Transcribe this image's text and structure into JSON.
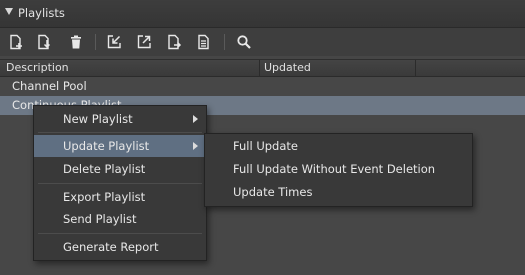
{
  "panel": {
    "title": "Playlists"
  },
  "toolbar": {
    "buttons": [
      {
        "icon": "new-playlist-icon"
      },
      {
        "icon": "import-playlist-icon"
      },
      {
        "icon": "trash-icon"
      },
      {
        "icon": "import-into-icon"
      },
      {
        "icon": "export-icon"
      },
      {
        "icon": "send-icon"
      },
      {
        "icon": "report-icon"
      },
      {
        "icon": "search-icon"
      }
    ]
  },
  "table": {
    "columns": [
      "Description",
      "Updated"
    ],
    "rows": [
      {
        "description": "Channel Pool",
        "updated": ""
      },
      {
        "description": "Continuous Playlist",
        "updated": ""
      }
    ]
  },
  "context_menu": {
    "items": [
      "New Playlist",
      "Update Playlist",
      "Delete Playlist",
      "Export Playlist",
      "Send Playlist",
      "Generate Report"
    ],
    "highlighted": "Update Playlist"
  },
  "submenu": {
    "items": [
      "Full Update",
      "Full Update Without Event Deletion",
      "Update Times"
    ]
  },
  "colors": {
    "background": "#464646",
    "selection": "#6d7886",
    "menu_highlight": "#5f6f82",
    "menu_background": "#393939"
  }
}
